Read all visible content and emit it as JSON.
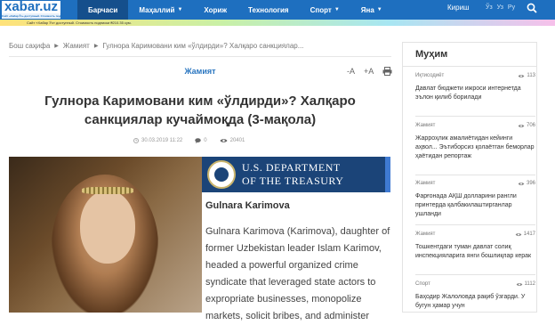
{
  "header": {
    "logo": "xabar.uz",
    "logo_tagline": "Сайт «Хабар Ўз» доступный. Стоимость подписки ₴210.35 сум.",
    "nav": [
      "Барчаси",
      "Маҳаллий",
      "Хориж",
      "Технология",
      "Спорт",
      "Яна"
    ],
    "nav_active_index": 0,
    "login": "Кириш",
    "languages": [
      "Ўз",
      "Уз",
      "Ру"
    ]
  },
  "breadcrumb": [
    "Бош саҳифа",
    "Жамият",
    "Гулнора Каримовани ким «ўлдирди»? Халқаро санкциялар..."
  ],
  "article": {
    "category": "Жамият",
    "font_minus": "-A",
    "font_plus": "+A",
    "title": "Гулнора Каримовани ким «ўлдирди»? Халқаро санкциялар кучаймоқда (3-мақола)",
    "date": "30.03.2019 11:22",
    "comments": "0",
    "views": "20401"
  },
  "treasury": {
    "line1": "U.S. DEPARTMENT",
    "line2": "OF THE TREASURY",
    "name": "Gulnara Karimova",
    "body": [
      "Gulnara Karimova (Karimova), daughter of",
      "former Uzbekistan leader Islam Karimov,",
      "headed a powerful organized crime",
      "syndicate that leveraged state actors to",
      "expropriate businesses, monopolize",
      "markets, solicit bribes, and administer"
    ]
  },
  "sidebar": {
    "title": "Муҳим",
    "items": [
      {
        "category": "Иқтисодиёт",
        "views": "113",
        "text": "Давлат бюджети ижроси интернетда эълон қилиб борилади"
      },
      {
        "category": "Жамият",
        "views": "706",
        "text": "Жарроҳлик амалиётидан кейинги аҳвол... Эътиборсиз қолаётган беморлар ҳаётидан репортаж"
      },
      {
        "category": "Жамият",
        "views": "396",
        "text": "Фарғонада АҚШ долларини рангли принтерда қалбакилаштирганлар ушланди"
      },
      {
        "category": "Жамият",
        "views": "1417",
        "text": "Тошкентдаги туман давлат солиқ инспекцияларига янги бошлиқлар керак"
      },
      {
        "category": "Спорт",
        "views": "1112",
        "text": "Баҳодир Жалоловда рақиб ўзгарди. У бугун ҳамар учун"
      }
    ]
  },
  "colors": {
    "brand": "#1e6fbf",
    "treasury": "#1b4478",
    "category": "#2a76c0"
  }
}
